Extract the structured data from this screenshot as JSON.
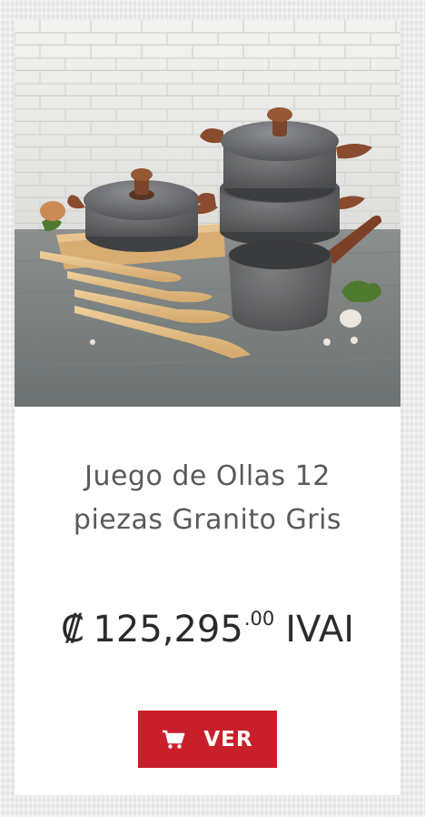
{
  "product": {
    "image_alt": "Juego de ollas granito gris con utensilios de madera",
    "title_line1": "Juego de Ollas 12",
    "title_line2": "piezas Granito Gris",
    "price": {
      "currency_symbol": "₡",
      "amount": "125,295",
      "cents": ".00",
      "tax_label": "IVAI"
    },
    "cta": {
      "icon": "cart-icon",
      "label": "VER"
    }
  },
  "colors": {
    "button": "#c8202a",
    "title_text": "#5a5a5a",
    "price_text": "#2b2b2b",
    "card_bg": "#ffffff",
    "page_bg": "#ececec"
  }
}
